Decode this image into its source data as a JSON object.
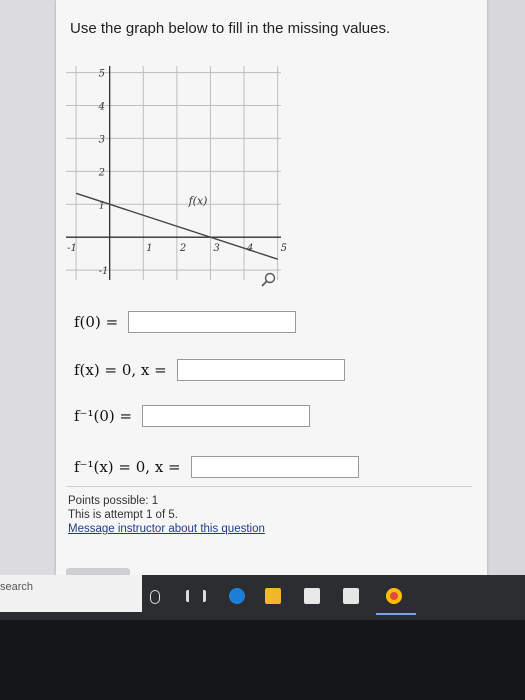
{
  "question": {
    "prompt": "Use the graph below to fill in the missing values."
  },
  "graph": {
    "function_label": "f(x)",
    "x_ticks": [
      "-1",
      "1",
      "2",
      "3",
      "4",
      "5"
    ],
    "y_ticks": [
      "5",
      "4",
      "3",
      "2",
      "1",
      "-1"
    ],
    "magnify_icon": "magnifier-icon"
  },
  "chart_data": {
    "type": "line",
    "series": [
      {
        "name": "f(x)",
        "x": [
          -1,
          5
        ],
        "y": [
          1.3333,
          -0.6667
        ]
      }
    ],
    "xlim": [
      -1.3,
      5.1
    ],
    "ylim": [
      -1.3,
      5.2
    ],
    "x_ticks": [
      "-1",
      "1",
      "2",
      "3",
      "4",
      "5"
    ],
    "y_ticks": [
      "5",
      "4",
      "3",
      "2",
      "1",
      "-1"
    ],
    "grid": true
  },
  "equations": [
    {
      "label": "f(0) ="
    },
    {
      "label": "f(x) = 0, x ="
    },
    {
      "label": "f⁻¹(0) ="
    },
    {
      "label": "f⁻¹(x) = 0, x ="
    }
  ],
  "info": {
    "points": "Points possible: 1",
    "attempt": "This is attempt 1 of 5.",
    "message_link": "Message instructor about this question"
  },
  "taskbar": {
    "search_placeholder": "search"
  },
  "colors": {
    "taskbar": "#2c2d31",
    "link": "#1f3c8c",
    "grid": "#bdbdbd"
  }
}
